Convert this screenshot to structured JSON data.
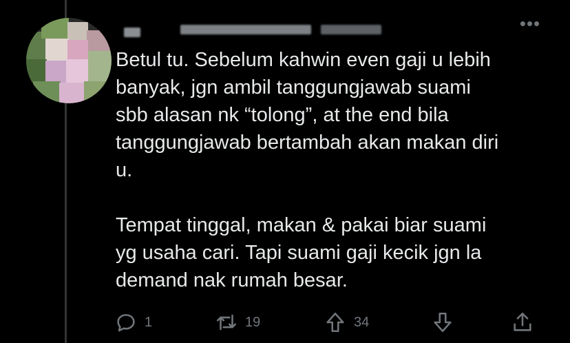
{
  "tweet": {
    "paragraphs": [
      "Betul tu. Sebelum kahwin even gaji u lebih\nbanyak, jgn ambil tanggungjawab suami\nsbb alasan nk “tolong”, at the end bila\ntanggungjawab bertambah akan makan diri\nu.",
      "Tempat tinggal, makan & pakai biar suami\nyg usaha cari. Tapi suami gaji kecik jgn la\ndemand nak rumah besar."
    ]
  },
  "more_label": "•••",
  "actions": {
    "reply_count": "1",
    "retweet_count": "19",
    "upvote_count": "34",
    "downvote_count": "",
    "share_count": ""
  },
  "colors": {
    "background": "#000000",
    "text": "#e7e9ea",
    "muted": "#71767b",
    "thread_line": "#333639"
  },
  "icons": [
    "reply-icon",
    "retweet-icon",
    "upvote-icon",
    "downvote-icon",
    "share-icon",
    "more-icon"
  ]
}
